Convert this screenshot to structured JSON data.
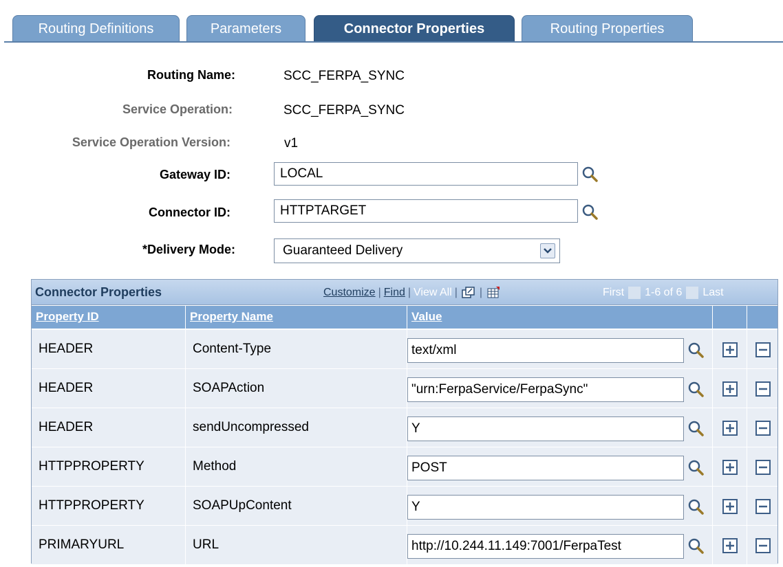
{
  "tabs": [
    {
      "label": "Routing Definitions",
      "active": false
    },
    {
      "label": "Parameters",
      "active": false
    },
    {
      "label": "Connector Properties",
      "active": true
    },
    {
      "label": "Routing Properties",
      "active": false
    }
  ],
  "form": {
    "routing_name_label": "Routing Name:",
    "routing_name_value": "SCC_FERPA_SYNC",
    "service_operation_label": "Service Operation:",
    "service_operation_value": "SCC_FERPA_SYNC",
    "service_operation_version_label": "Service Operation Version:",
    "service_operation_version_value": "v1",
    "gateway_id_label": "Gateway ID:",
    "gateway_id_value": "LOCAL",
    "connector_id_label": "Connector ID:",
    "connector_id_value": "HTTPTARGET",
    "delivery_mode_label": "*Delivery Mode:",
    "delivery_mode_value": "Guaranteed Delivery"
  },
  "grid": {
    "title": "Connector Properties",
    "customize": "Customize",
    "find": "Find",
    "view_all": "View All",
    "first": "First",
    "range": "1-6 of 6",
    "last": "Last",
    "columns": [
      "Property ID",
      "Property Name",
      "Value"
    ],
    "rows": [
      {
        "property_id": "HEADER",
        "property_name": "Content-Type",
        "value": "text/xml"
      },
      {
        "property_id": "HEADER",
        "property_name": "SOAPAction",
        "value": "\"urn:FerpaService/FerpaSync\""
      },
      {
        "property_id": "HEADER",
        "property_name": "sendUncompressed",
        "value": "Y"
      },
      {
        "property_id": "HTTPPROPERTY",
        "property_name": "Method",
        "value": "POST"
      },
      {
        "property_id": "HTTPPROPERTY",
        "property_name": "SOAPUpContent",
        "value": "Y"
      },
      {
        "property_id": "PRIMARYURL",
        "property_name": "URL",
        "value": "http://10.244.11.149:7001/FerpaTest"
      }
    ]
  },
  "colors": {
    "tab_inactive": "#79a1cb",
    "tab_active": "#345c87",
    "grid_header": "#a8c3e3",
    "column_header": "#7da6d3",
    "row_bg": "#e9eef5"
  },
  "icons": {
    "lookup": "magnifier-icon",
    "add_row": "plus-icon",
    "delete_row": "minus-icon",
    "dropdown": "chevron-down-icon",
    "zoom": "zoom-grid-icon",
    "download": "spreadsheet-icon",
    "pager": "arrow-icon"
  }
}
